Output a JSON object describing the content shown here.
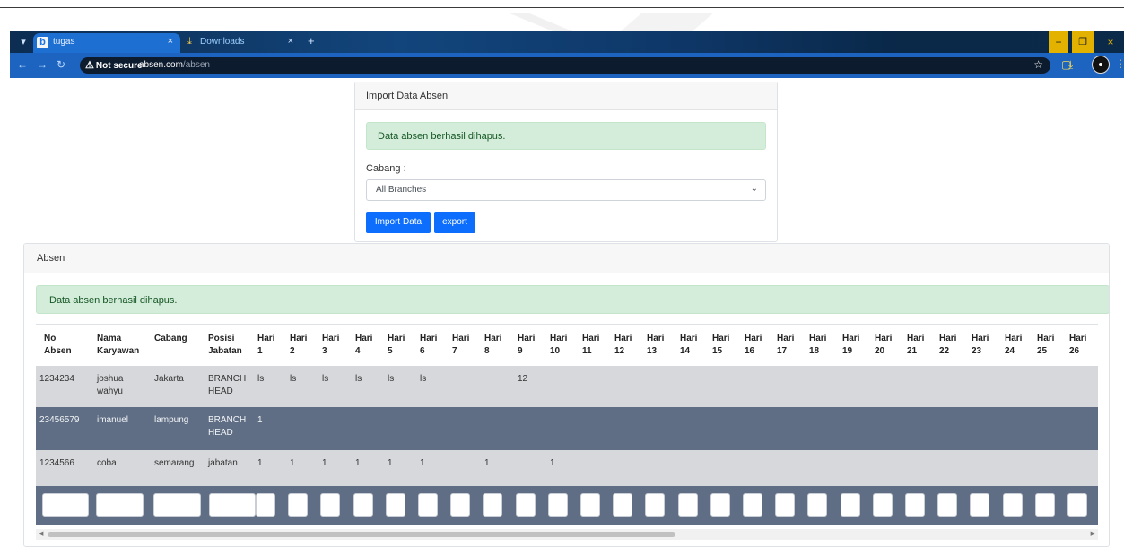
{
  "browser": {
    "tabs": [
      {
        "title": "tugas",
        "active": true
      },
      {
        "title": "Downloads",
        "active": false
      }
    ],
    "new_tab": "+",
    "security_label": "Not secure",
    "url_host": "absen.com",
    "url_path": "/absen",
    "icons": {
      "tab_menu": "▾",
      "tab_favicon": "b",
      "close": "×",
      "download": "⤓",
      "back": "←",
      "forward": "→",
      "reload": "↻",
      "warning": "⚠",
      "star": "☆",
      "extensions": "▢",
      "sidebar": "◧",
      "more": "⋮",
      "minimize": "−",
      "restore": "❐"
    }
  },
  "import_card": {
    "header": "Import Data Absen",
    "alert": "Data absen berhasil dihapus.",
    "cabang_label": "Cabang :",
    "select_value": "All Branches",
    "import_button": "Import Data",
    "export_button": "export"
  },
  "absen_card": {
    "header": "Absen",
    "alert": "Data absen berhasil dihapus.",
    "columns": {
      "no_absen": [
        "No",
        "Absen"
      ],
      "nama": [
        "Nama",
        "Karyawan"
      ],
      "cabang": [
        "Cabang",
        ""
      ],
      "posisi": [
        "Posisi",
        "Jabatan"
      ],
      "day_word": "Hari",
      "days": [
        "1",
        "2",
        "3",
        "4",
        "5",
        "6",
        "7",
        "8",
        "9",
        "10",
        "11",
        "12",
        "13",
        "14",
        "15",
        "16",
        "17",
        "18",
        "19",
        "20",
        "21",
        "22",
        "23",
        "24",
        "25",
        "26"
      ]
    },
    "rows": [
      {
        "no": "1234234",
        "nama": [
          "joshua",
          "wahyu"
        ],
        "cabang": "Jakarta",
        "posisi": [
          "BRANCH",
          "HEAD"
        ],
        "days": [
          "ls",
          "ls",
          "ls",
          "ls",
          "ls",
          "ls",
          "",
          "",
          "12",
          "",
          "",
          "",
          "",
          "",
          "",
          "",
          "",
          "",
          "",
          "",
          "",
          "",
          "",
          "",
          "",
          ""
        ]
      },
      {
        "no": "23456579",
        "nama": [
          "imanuel",
          ""
        ],
        "cabang": "lampung",
        "posisi": [
          "BRANCH",
          "HEAD"
        ],
        "days": [
          "1",
          "",
          "",
          "",
          "",
          "",
          "",
          "",
          "",
          "",
          "",
          "",
          "",
          "",
          "",
          "",
          "",
          "",
          "",
          "",
          "",
          "",
          "",
          "",
          "",
          ""
        ]
      },
      {
        "no": "1234566",
        "nama": [
          "coba",
          ""
        ],
        "cabang": "semarang",
        "posisi": [
          "jabatan",
          ""
        ],
        "days": [
          "1",
          "1",
          "1",
          "1",
          "1",
          "1",
          "",
          "1",
          "",
          "1",
          "",
          "",
          "",
          "",
          "",
          "",
          "",
          "",
          "",
          "",
          "",
          "",
          "",
          "",
          "",
          ""
        ]
      }
    ]
  }
}
